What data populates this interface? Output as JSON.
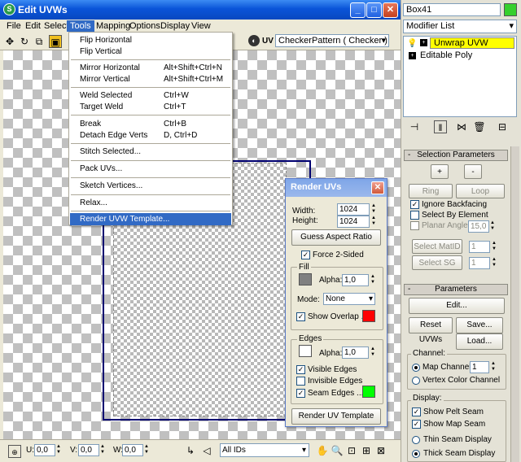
{
  "window": {
    "title": "Edit UVWs"
  },
  "menubar": {
    "items": [
      "File",
      "Edit",
      "Select",
      "Tools",
      "Mapping",
      "Options",
      "Display",
      "View"
    ]
  },
  "toolbar": {
    "uv_label": "UV",
    "checker_value": "CheckerPattern  ( Checker )"
  },
  "tools_menu": {
    "groups": [
      [
        {
          "label": "Flip Horizontal",
          "shortcut": ""
        },
        {
          "label": "Flip Vertical",
          "shortcut": ""
        }
      ],
      [
        {
          "label": "Mirror Horizontal",
          "shortcut": "Alt+Shift+Ctrl+N"
        },
        {
          "label": "Mirror Vertical",
          "shortcut": "Alt+Shift+Ctrl+M"
        }
      ],
      [
        {
          "label": "Weld Selected",
          "shortcut": "Ctrl+W"
        },
        {
          "label": "Target Weld",
          "shortcut": "Ctrl+T"
        }
      ],
      [
        {
          "label": "Break",
          "shortcut": "Ctrl+B"
        },
        {
          "label": "Detach Edge Verts",
          "shortcut": "D, Ctrl+D"
        }
      ],
      [
        {
          "label": "Stitch Selected...",
          "shortcut": ""
        }
      ],
      [
        {
          "label": "Pack UVs...",
          "shortcut": ""
        }
      ],
      [
        {
          "label": "Sketch Vertices...",
          "shortcut": ""
        }
      ],
      [
        {
          "label": "Relax...",
          "shortcut": ""
        }
      ],
      [
        {
          "label": "Render UVW Template...",
          "shortcut": ""
        }
      ]
    ]
  },
  "render_dialog": {
    "title": "Render UVs",
    "width_label": "Width:",
    "width_value": "1024",
    "height_label": "Height:",
    "height_value": "1024",
    "guess_button": "Guess Aspect Ratio",
    "force_label": "Force 2-Sided",
    "fill": {
      "group": "Fill",
      "alpha_label": "Alpha:",
      "alpha_value": "1,0",
      "mode_label": "Mode:",
      "mode_value": "None",
      "show_overlap": "Show Overlap ...",
      "color": "#808080",
      "overlap_color": "#ff0000"
    },
    "edges": {
      "group": "Edges",
      "alpha_label": "Alpha:",
      "alpha_value": "1,0",
      "visible": "Visible Edges",
      "invisible": "Invisible Edges",
      "seam": "Seam Edges ....",
      "color": "#ffffff",
      "seam_color": "#00ff00"
    },
    "render_button": "Render UV Template"
  },
  "statusbar": {
    "u_label": "U:",
    "u_value": "0,0",
    "v_label": "V:",
    "v_value": "0,0",
    "w_label": "W:",
    "w_value": "0,0",
    "ids_value": "All IDs"
  },
  "right_panel": {
    "object_name": "Box41",
    "object_color": "#36d02d",
    "modifier_list": "Modifier List",
    "stack": [
      {
        "label": "Unwrap UVW",
        "selected": true
      },
      {
        "label": "Editable Poly",
        "selected": false
      }
    ],
    "selection_params": {
      "header": "Selection Parameters",
      "plus": "+",
      "minus": "-",
      "ring": "Ring",
      "loop": "Loop",
      "ignore_backfacing": "Ignore Backfacing",
      "select_by_element": "Select By Element",
      "planar_angle": "Planar Angle",
      "planar_value": "15,0",
      "select_matid": "Select MatID",
      "matid_value": "1",
      "select_sg": "Select SG",
      "sg_value": "1"
    },
    "parameters": {
      "header": "Parameters",
      "edit": "Edit...",
      "reset": "Reset UVWs",
      "save": "Save...",
      "load": "Load...",
      "channel_group": "Channel:",
      "map_channel": "Map Channel:",
      "map_channel_value": "1",
      "vertex_color": "Vertex Color Channel",
      "display_group": "Display:",
      "show_pelt": "Show Pelt Seam",
      "show_map": "Show Map Seam",
      "thin_seam": "Thin Seam Display",
      "thick_seam": "Thick Seam Display"
    }
  }
}
